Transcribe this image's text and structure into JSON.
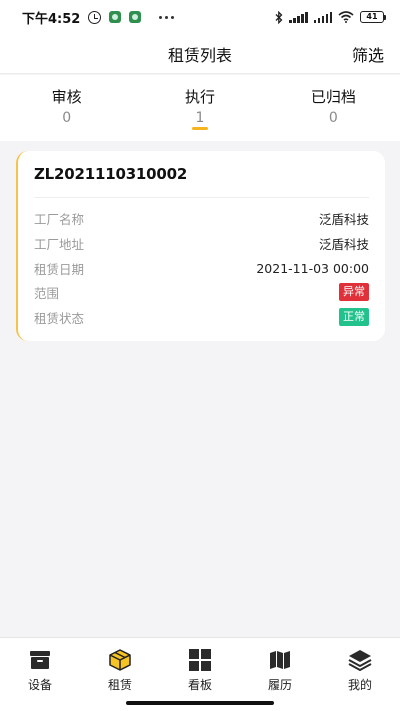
{
  "status_bar": {
    "time": "下午4:52",
    "battery": "41",
    "icons": [
      "alarm-icon",
      "app-badge-icon",
      "app-badge-icon",
      "more-dots-icon",
      "bluetooth-icon",
      "signal-icon",
      "signal-hd-icon",
      "wifi-icon",
      "battery-icon"
    ]
  },
  "header": {
    "title": "租赁列表",
    "filter_label": "筛选"
  },
  "tabs": [
    {
      "label": "审核",
      "count": "0"
    },
    {
      "label": "执行",
      "count": "1"
    },
    {
      "label": "已归档",
      "count": "0"
    }
  ],
  "active_tab": "执行",
  "card": {
    "id": "ZL2021110310002",
    "rows": [
      {
        "label": "工厂名称",
        "value": "泛盾科技"
      },
      {
        "label": "工厂地址",
        "value": "泛盾科技"
      },
      {
        "label": "租赁日期",
        "value": "2021-11-03 00:00"
      },
      {
        "label": "范围",
        "value": "异常"
      },
      {
        "label": "租赁状态",
        "value": "正常"
      }
    ]
  },
  "nav": [
    {
      "label": "设备",
      "icon": "inbox-icon"
    },
    {
      "label": "租赁",
      "icon": "box-icon"
    },
    {
      "label": "看板",
      "icon": "grid-icon"
    },
    {
      "label": "履历",
      "icon": "map-icon"
    },
    {
      "label": "我的",
      "icon": "layers-icon"
    }
  ],
  "colors": {
    "accent": "#f6b51d",
    "abnormal": "#e0303a",
    "normal": "#22c28c"
  }
}
